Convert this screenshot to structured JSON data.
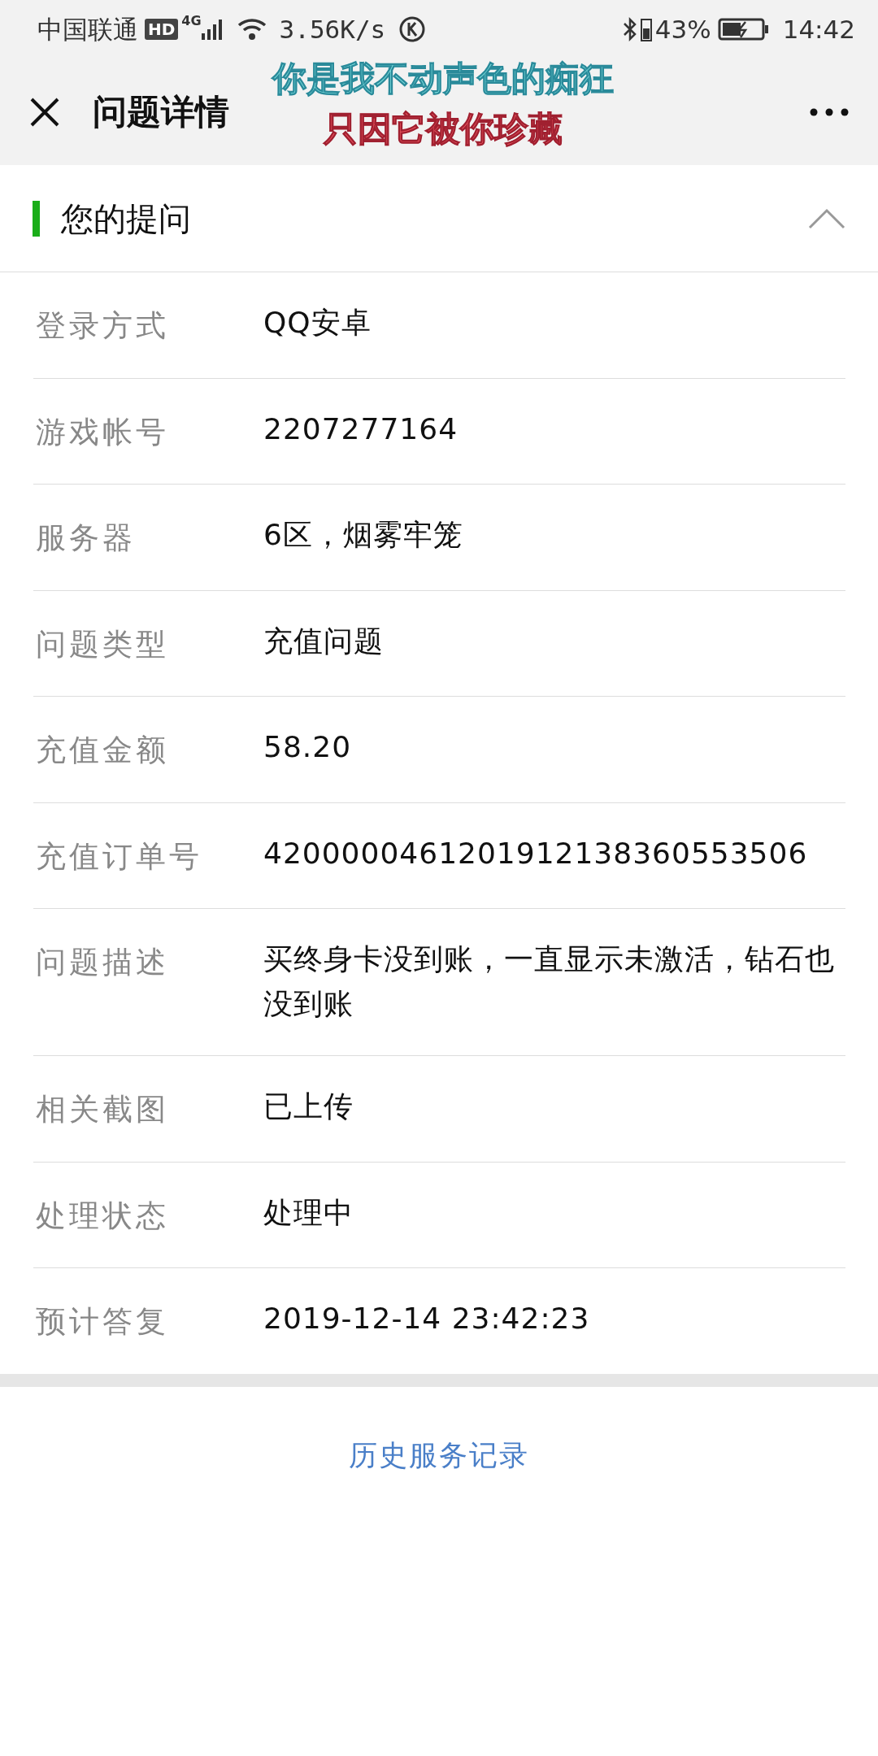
{
  "status_bar": {
    "carrier": "中国联通",
    "hd": "HD",
    "network": "4G",
    "speed": "3.56K/s",
    "battery": "43%",
    "time": "14:42"
  },
  "header": {
    "title": "问题详情"
  },
  "overlay_caption": [
    "你是我不动声色的痴狂",
    "只因它被你珍藏"
  ],
  "section": {
    "title": "您的提问",
    "expanded": true
  },
  "rows": [
    {
      "label": "登录方式",
      "value": "QQ安卓"
    },
    {
      "label": "游戏帐号",
      "value": "2207277164"
    },
    {
      "label": "服务器",
      "value": "6区，烟雾牢笼"
    },
    {
      "label": "问题类型",
      "value": "充值问题"
    },
    {
      "label": "充值金额",
      "value": "58.20"
    },
    {
      "label": "充值订单号",
      "value": "4200000461201912138360553506"
    },
    {
      "label": "问题描述",
      "value": "买终身卡没到账，一直显示未激活，钻石也没到账"
    },
    {
      "label": "相关截图",
      "value": "已上传"
    },
    {
      "label": "处理状态",
      "value": "处理中"
    },
    {
      "label": "预计答复",
      "value": "2019-12-14 23:42:23"
    }
  ],
  "history_link": "历史服务记录"
}
